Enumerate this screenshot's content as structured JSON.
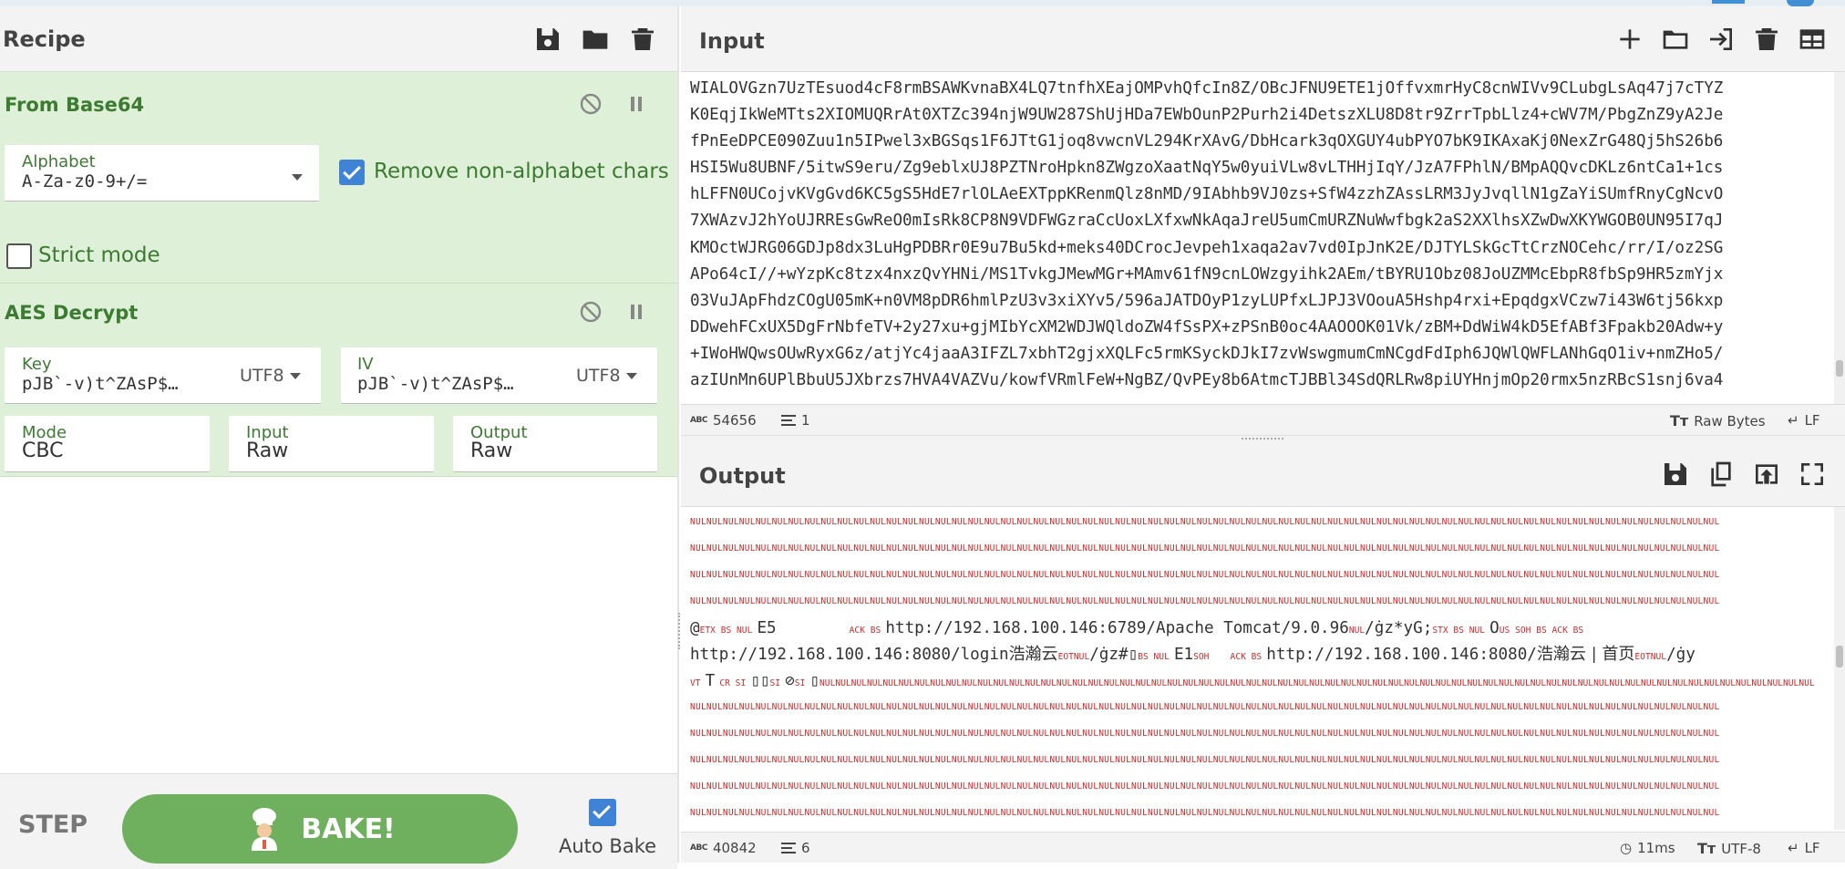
{
  "recipe": {
    "title": "Recipe",
    "header_icons": [
      "save-icon",
      "folder-icon",
      "trash-icon"
    ],
    "operations": {
      "from_base64": {
        "title": "From Base64",
        "alphabet_label": "Alphabet",
        "alphabet_value": "A-Za-z0-9+/=",
        "remove_non_alphabet_label": "Remove non-alphabet chars",
        "remove_non_alphabet_checked": true,
        "strict_mode_label": "Strict mode",
        "strict_mode_checked": false
      },
      "aes_decrypt": {
        "title": "AES Decrypt",
        "key_label": "Key",
        "key_value": "pJB`-v)t^ZAsP$…",
        "key_encoding": "UTF8",
        "iv_label": "IV",
        "iv_value": "pJB`-v)t^ZAsP$…",
        "iv_encoding": "UTF8",
        "mode_label": "Mode",
        "mode_value": "CBC",
        "input_label": "Input",
        "input_value": "Raw",
        "output_label": "Output",
        "output_value": "Raw"
      }
    },
    "controls": {
      "step_label": "STEP",
      "bake_label": "BAKE!",
      "auto_bake_label": "Auto Bake",
      "auto_bake_checked": true
    }
  },
  "input": {
    "title": "Input",
    "header_icons": [
      "plus-icon",
      "folder-icon",
      "sign-in-icon",
      "trash-icon",
      "layout-icon"
    ],
    "lines": [
      "WIALOVGzn7UzTEsuod4cF8rmBSAWKvnaBX4LQ7tnfhXEajOMPvhQfcIn8Z/OBcJFNU9ETE1jOffvxmrHyC8cnWIVv9CLubgLsAq47j7cTYZ",
      "K0EqjIkWeMTts2XIOMUQRrAt0XTZc394njW9UW287ShUjHDa7EWbOunP2Purh2i4DetszXLU8D8tr9ZrrTpbLlz4+cWV7M/PbgZnZ9yA2Je",
      "fPnEeDPCE090Zuu1n5IPwel3xBGSqs1F6JTtG1joq8vwcnVL294KrXAvG/DbHcark3qOXGUY4ubPYO7bK9IKAxaKj0NexZrG48Qj5hS26b6",
      "HSI5Wu8UBNF/5itwS9eru/Zg9eblxUJ8PZTNroHpkn8ZWgzoXaatNqY5w0yuiVLw8vLTHHjIqY/JzA7FPhlN/BMpAQQvcDKLz6ntCa1+1cs",
      "hLFFN0UCojvKVgGvd6KC5gS5HdE7rlOLAeEXTppKRenmQlz8nMD/9IAbhb9VJ0zs+SfW4zzhZAssLRM3JyJvqllN1gZaYiSUmfRnyCgNcvO",
      "7XWAzvJ2hYoUJRREsGwReO0mIsRk8CP8N9VDFWGzraCcUoxLXfxwNkAqaJreU5umCmURZNuWwfbgk2aS2XXlhsXZwDwXKYWGOB0UN95I7qJ",
      "KMOctWJRG06GDJp8dx3LuHgPDBRr0E9u7Bu5kd+meks40DCrocJevpeh1xaqa2av7vd0IpJnK2E/DJTYLSkGcTtCrzNOCehc/rr/I/oz2SG",
      "APo64cI//+wYzpKc8tzx4nxzQvYHNi/MS1TvkgJMewMGr+MAmv61fN9cnLOWzgyihk2AEm/tBYRU1Obz08JoUZMMcEbpR8fbSp9HR5zmYjx",
      "03VuJApFhdzCOgU05mK+n0VM8pDR6hmlPzU3v3xiXYv5/596aJATDOyP1zyLUPfxLJPJ3VOouA5Hshp4rxi+EpqdgxVCzw7i43W6tj56kxp",
      "DDwehFCxUX5DgFrNbfeTV+2y27xu+gjMIbYcXM2WDJWQldoZW4fSsPX+zPSnB0oc4AAOOOK01Vk/zBM+DdWiW4kD5EfABf3Fpakb20Adw+y",
      "+IWoHWQwsOUwRyxG6z/atjYc4jaaA3IFZL7xbhT2gjxXQLFc5rmKSyckDJkI7zvWswgmumCmNCgdFdIph6JQWlQWFLANhGqO1iv+nmZHo5/",
      "azIUnMn6UPlBbuU5JXbrzs7HVA4VAZVu/kowfVRmlFeW+NgBZ/QvPEy8b6AtmcTJBBl34SdQRLRw8piUYHnjmOp20rmx5nzRBcS1snj6va4"
    ],
    "status": {
      "char_count": "54656",
      "line_count": "1",
      "raw_bytes_label": "Raw Bytes",
      "eol_label": "LF"
    }
  },
  "output": {
    "title": "Output",
    "header_icons": [
      "save-icon",
      "copy-icon",
      "replace-input-icon",
      "fullscreen-icon"
    ],
    "nul_row": "NULNULNULNULNULNULNULNULNULNULNULNULNULNULNULNULNULNULNULNULNULNULNULNULNULNULNULNULNULNULNULNULNULNULNULNULNULNULNULNULNULNULNULNULNULNULNULNULNULNULNULNULNULNULNULNULNULNULNULNULNULNULNUL",
    "line1": {
      "p1": "@",
      "c1": "ETX BS NUL",
      "p2": "E5",
      "c2": "ACK BS",
      "p3": "http://192.168.100.146:6789/Apache Tomcat/9.0.96",
      "c3": "NUL",
      "p4": "/ġz*yG;",
      "c4": "STX BS NUL",
      "p5": "O",
      "c5": "US SOH BS ACK BS"
    },
    "line2": {
      "p1": "http://192.168.100.146:8080/login",
      "p2": "浩瀚云",
      "c1": "EOTNUL",
      "p3": "/ġz#▯",
      "c2": "BS NUL",
      "p4": "E1",
      "c3": "SOH",
      "c4": "ACK BS",
      "p5": "http://192.168.100.146:8080/",
      "p6": "浩瀚云 | 首页",
      "c5": "EOTNUL",
      "p7": "/ġy"
    },
    "line3": {
      "c1": "VT",
      "p1": "T",
      "c2": "CR SI",
      "p2": "▯▯",
      "c3": "SI",
      "p3": "⊘",
      "c4": "SI",
      "p4": "▯"
    },
    "status": {
      "char_count": "40842",
      "line_count": "6",
      "time": "11ms",
      "encoding": "UTF-8",
      "eol_label": "LF"
    }
  },
  "colors": {
    "op_bg": "#dff0d8",
    "op_title": "#3d7a32",
    "bake": "#6fb05f",
    "checkbox": "#3f83d6",
    "control_char": "#d32b2b"
  }
}
